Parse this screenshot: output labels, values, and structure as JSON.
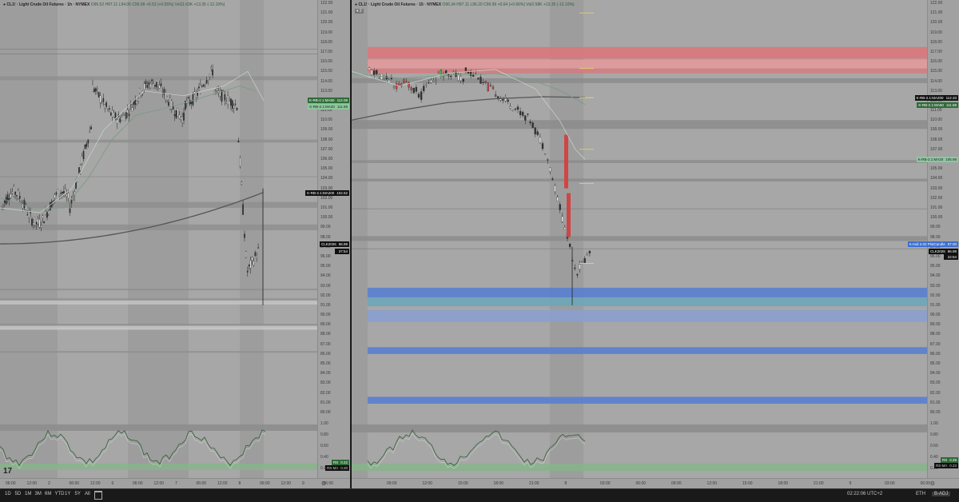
{
  "left_chart": {
    "legend": {
      "symbol": "CL1! · Light Crude Oil Futures · 1h · NYMEX",
      "ohlc": "O96.52 H97.11 L94.05 C96.99 +0.53 (+0.55%) Vol11.63K +13.35 (-12.10%)"
    },
    "price_ticks": [
      "122.00",
      "121.00",
      "120.00",
      "119.00",
      "118.00",
      "117.00",
      "116.00",
      "115.00",
      "114.00",
      "113.00",
      "112.00",
      "111.00",
      "110.00",
      "109.00",
      "108.00",
      "107.00",
      "106.00",
      "105.00",
      "104.00",
      "103.00",
      "102.00",
      "101.00",
      "100.00",
      "99.00",
      "98.00",
      "97.00",
      "96.00",
      "95.00",
      "94.00",
      "93.00",
      "92.00",
      "91.00",
      "90.00",
      "89.00",
      "88.00",
      "87.00",
      "86.00",
      "85.00",
      "84.00",
      "83.00",
      "82.00",
      "81.00",
      "80.00"
    ],
    "time_ticks": [
      "06:00",
      "12:00",
      "2",
      "06:00",
      "12:00",
      "6",
      "06:00",
      "12:00",
      "7",
      "06:00",
      "12:00",
      "8",
      "06:00",
      "12:00",
      "9",
      "06:00"
    ],
    "tags": [
      {
        "label": "K-RB-2.1:MA50",
        "value": "112.08"
      },
      {
        "label": "K-RB-2.1:MA20",
        "value": "111.89"
      },
      {
        "label": "K-RB-2.1:MA200",
        "value": "102.52"
      },
      {
        "label": "CLK2026",
        "value": "96.99"
      },
      {
        "label": "",
        "value": "37:54"
      }
    ],
    "osc_ticks": [
      "1.00",
      "0.80",
      "0.60",
      "0.40",
      "0.20"
    ],
    "osc_tags": [
      {
        "label": "RS",
        "value": "0.22"
      },
      {
        "label": "RS MA",
        "value": "0.20"
      }
    ]
  },
  "right_chart": {
    "legend": {
      "symbol": "CL1! · Light Crude Oil Futures · 15 · NYMEX",
      "ohlc": "O96.34 H97.11 L96.20 C96.99 +0.64 (+0.66%) Vol2.58K +13.35 (-12.10%)"
    },
    "badge": "2",
    "price_ticks": [
      "122.00",
      "121.00",
      "120.00",
      "119.00",
      "118.00",
      "117.00",
      "116.00",
      "115.00",
      "114.00",
      "113.00",
      "112.00",
      "111.00",
      "110.00",
      "109.00",
      "108.00",
      "107.00",
      "106.00",
      "105.00",
      "104.00",
      "103.00",
      "102.00",
      "101.00",
      "100.00",
      "99.00",
      "98.00",
      "97.00",
      "96.00",
      "95.00",
      "94.00",
      "93.00",
      "92.00",
      "91.00",
      "90.00",
      "89.00",
      "88.00",
      "87.00",
      "86.00",
      "85.00",
      "84.00",
      "83.00",
      "82.00",
      "81.00",
      "80.00"
    ],
    "time_ticks": [
      "09:00",
      "12:00",
      "15:00",
      "18:00",
      "21:00",
      "8",
      "03:00",
      "06:00",
      "09:00",
      "12:00",
      "15:00",
      "18:00",
      "21:00",
      "9",
      "03:00",
      "06:00"
    ],
    "tags": [
      {
        "label": "K-RB-2.1:MA200",
        "value": "112.33"
      },
      {
        "label": "K-RB-2.1:MA50",
        "value": "111.58"
      },
      {
        "label": "K-RB-2.1:MA20",
        "value": "105.98"
      },
      {
        "label": "K-Indi 2.02 PlotCandle",
        "value": "97.00"
      },
      {
        "label": "CLK2026",
        "value": "96.99"
      },
      {
        "label": "",
        "value": "22:54"
      }
    ],
    "osc_ticks": [
      "1.00",
      "0.80",
      "0.60",
      "0.40",
      "0.20"
    ],
    "osc_tags": [
      {
        "label": "RS",
        "value": "0.29"
      },
      {
        "label": "RS MA",
        "value": "0.23"
      }
    ]
  },
  "bottom_bar": {
    "ranges": [
      "1D",
      "5D",
      "1M",
      "3M",
      "6M",
      "YTD",
      "1Y",
      "5Y",
      "All"
    ],
    "clock": "02:22:06 UTC+2",
    "session": "ETH",
    "adjust": "B-ADJ"
  },
  "colors": {
    "chart_bg": "#a7a7a7",
    "supply_zone": "#d9787c",
    "demand_zone": "#5a7fcf",
    "up_candle": "#e8e8e8",
    "down_candle": "#d04545",
    "ma200": "#555555",
    "ma50": "#7d9a84"
  }
}
